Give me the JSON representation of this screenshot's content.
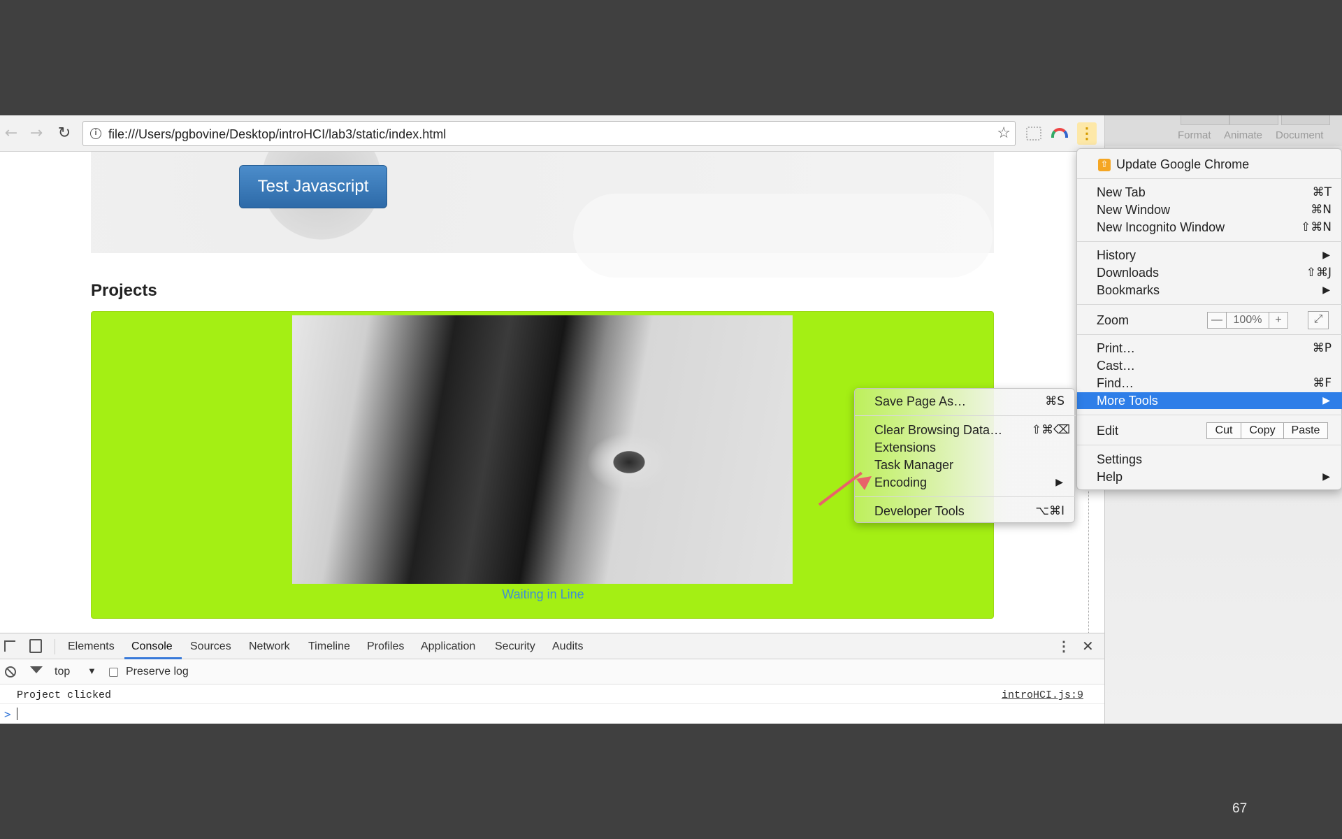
{
  "browser": {
    "url": "file:///Users/pgbovine/Desktop/introHCI/lab3/static/index.html"
  },
  "side_panel": {
    "tabs": [
      "Format",
      "Animate",
      "Document"
    ]
  },
  "page": {
    "test_button_label": "Test Javascript",
    "projects_heading": "Projects",
    "project_caption": "Waiting in Line"
  },
  "chrome_menu": {
    "update_label": "Update Google Chrome",
    "new_tab": {
      "label": "New Tab",
      "shortcut": "⌘T"
    },
    "new_window": {
      "label": "New Window",
      "shortcut": "⌘N"
    },
    "new_incognito": {
      "label": "New Incognito Window",
      "shortcut": "⇧⌘N"
    },
    "history": {
      "label": "History",
      "arrow": "▶"
    },
    "downloads": {
      "label": "Downloads",
      "shortcut": "⇧⌘J"
    },
    "bookmarks": {
      "label": "Bookmarks",
      "arrow": "▶"
    },
    "zoom": {
      "label": "Zoom",
      "minus": "—",
      "value": "100%",
      "plus": "+",
      "fullscreen": "⤢"
    },
    "print": {
      "label": "Print…",
      "shortcut": "⌘P"
    },
    "cast": {
      "label": "Cast…"
    },
    "find": {
      "label": "Find…",
      "shortcut": "⌘F"
    },
    "more_tools": {
      "label": "More Tools",
      "arrow": "▶"
    },
    "edit": {
      "label": "Edit",
      "cut": "Cut",
      "copy": "Copy",
      "paste": "Paste"
    },
    "settings": {
      "label": "Settings"
    },
    "help": {
      "label": "Help",
      "arrow": "▶"
    }
  },
  "more_tools_menu": {
    "save_page": {
      "label": "Save Page As…",
      "shortcut": "⌘S"
    },
    "clear_browsing": {
      "label": "Clear Browsing Data…",
      "shortcut": "⇧⌘⌫"
    },
    "extensions": {
      "label": "Extensions"
    },
    "task_manager": {
      "label": "Task Manager"
    },
    "encoding": {
      "label": "Encoding",
      "arrow": "▶"
    },
    "developer_tools": {
      "label": "Developer Tools",
      "shortcut": "⌥⌘I"
    }
  },
  "devtools": {
    "tabs": [
      "Elements",
      "Console",
      "Sources",
      "Network",
      "Timeline",
      "Profiles",
      "Application",
      "Security",
      "Audits"
    ],
    "active_tab": "Console",
    "context": "top",
    "context_arrow": "▼",
    "preserve_log_label": "Preserve log",
    "log_message": "Project clicked",
    "log_source": "introHCI.js:9",
    "prompt": ">",
    "kebab": "⋮",
    "close": "✕"
  },
  "slide_number": "67",
  "colors": {
    "slide_background": "#404040",
    "project_card": "#a4ef14",
    "button_blue": "#2d6aa8",
    "menu_highlight": "#2e7ee8",
    "annotation_arrow": "#e8626a"
  }
}
